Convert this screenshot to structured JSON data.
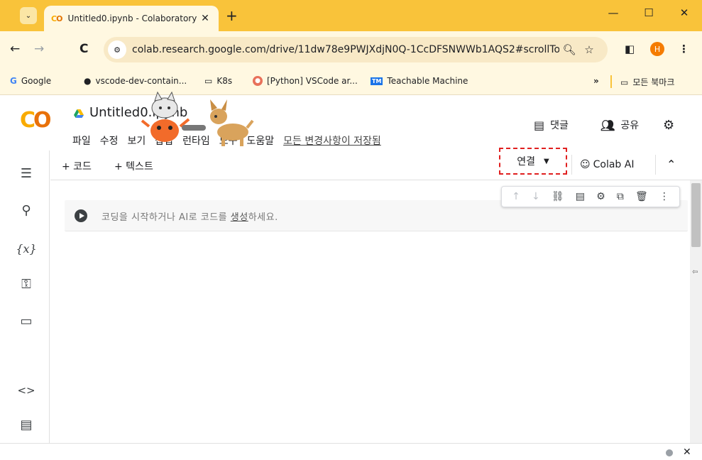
{
  "browser": {
    "tab_title": "Untitled0.ipynb - Colaboratory",
    "tab_close": "✕",
    "new_tab": "+",
    "url": "colab.research.google.com/drive/11dw78e9PWJXdjN0Q-1CcDFSNWWb1AQS2#scrollTo...",
    "profile_initial": "H",
    "window": {
      "minimize": "—",
      "maximize": "☐",
      "close": "✕"
    }
  },
  "bookmarks": [
    {
      "label": "Google",
      "icon": "google-icon"
    },
    {
      "label": "vscode-dev-contain...",
      "icon": "github-icon"
    },
    {
      "label": "K8s",
      "icon": "folder-icon"
    },
    {
      "label": "[Python] VSCode ar...",
      "icon": "python-icon"
    },
    {
      "label": "Teachable Machine",
      "icon": "tm-icon"
    }
  ],
  "bookmarks_more": "»",
  "bookmarks_all": "모든 북마크",
  "colab": {
    "logo": "CO",
    "notebook_name": "Untitled0.ipynb",
    "menu": [
      "파일",
      "수정",
      "보기",
      "삽입",
      "런타임",
      "도구",
      "도움말"
    ],
    "saved_status": "모든 변경사항이 저장됨",
    "comment_label": "댓글",
    "share_label": "공유"
  },
  "toolbar": {
    "add_code": "+ 코드",
    "add_text": "+ 텍스트",
    "connect_label": "연결",
    "colab_ai_label": "Colab AI"
  },
  "cell": {
    "placeholder_before": "코딩을 시작하거나 AI로 코드를 ",
    "placeholder_link": "생성",
    "placeholder_after": "하세요."
  },
  "sidebar_icons": [
    "toc-icon",
    "search-icon",
    "variables-icon",
    "secrets-key-icon",
    "files-folder-icon",
    "code-snippets-icon",
    "terminal-icon"
  ]
}
